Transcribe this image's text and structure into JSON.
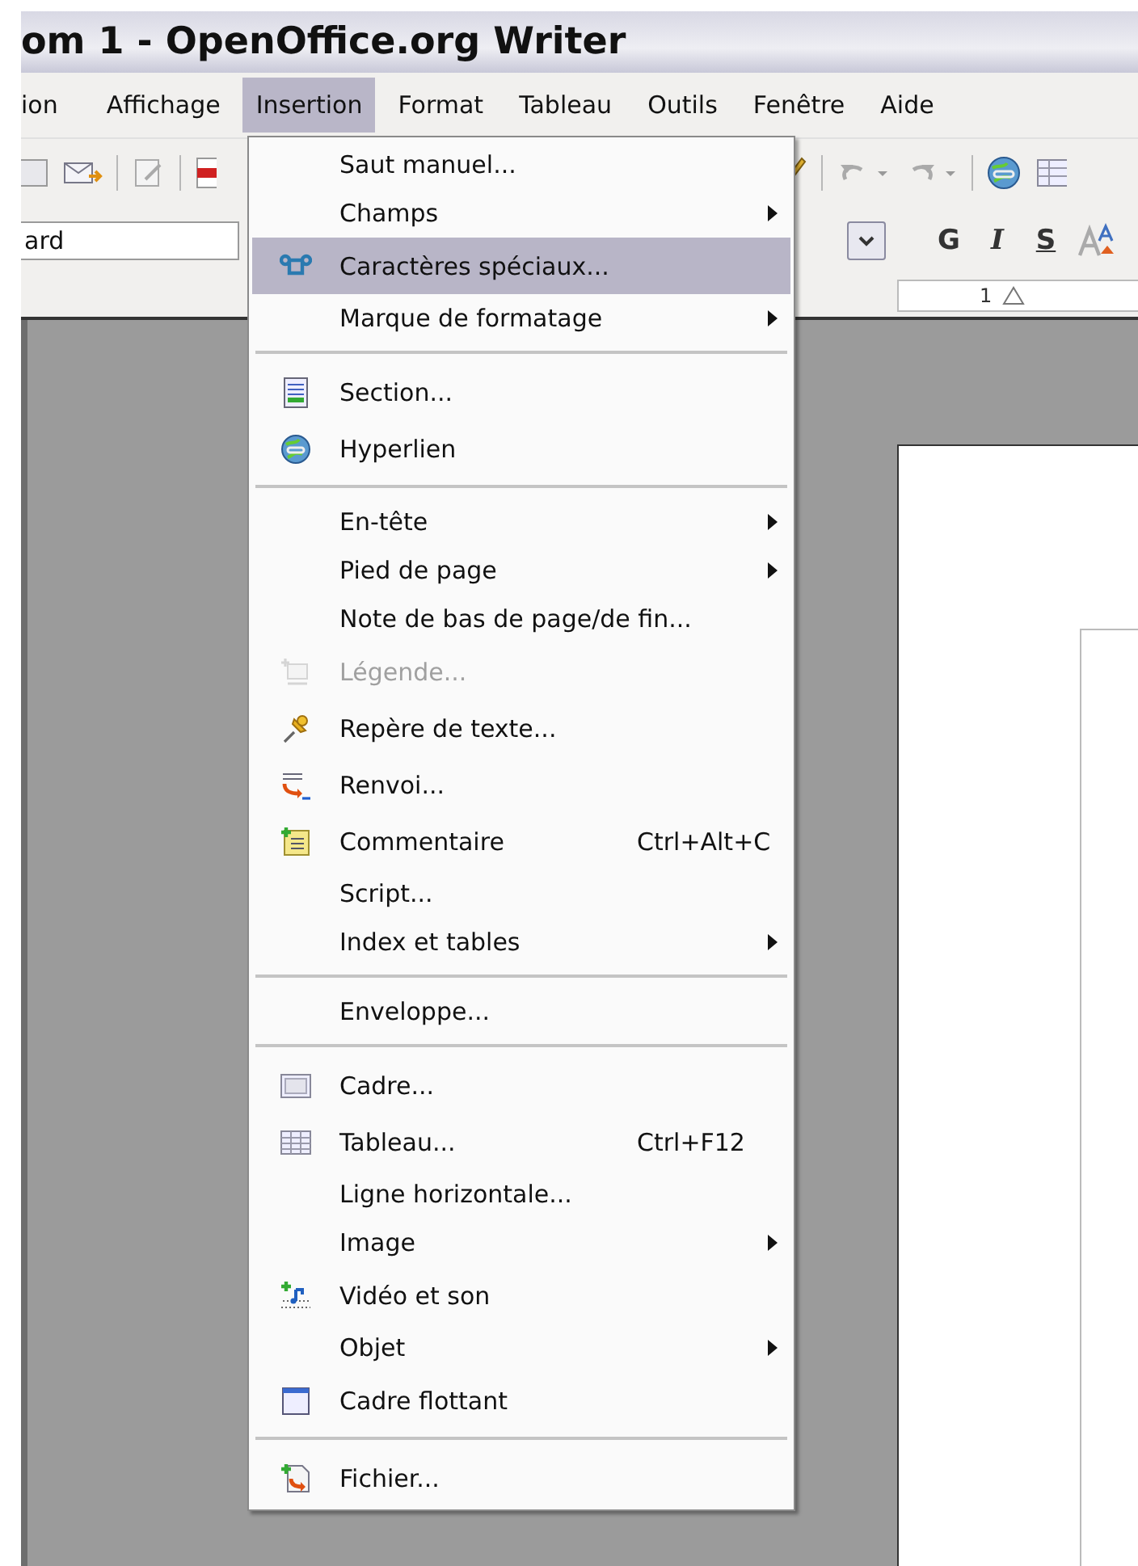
{
  "window": {
    "title": "om 1 - OpenOffice.org Writer"
  },
  "menubar": [
    {
      "label": "ion",
      "selected": false
    },
    {
      "label": "Affichage",
      "selected": false
    },
    {
      "label": "Insertion",
      "selected": true
    },
    {
      "label": "Format",
      "selected": false
    },
    {
      "label": "Tableau",
      "selected": false
    },
    {
      "label": "Outils",
      "selected": false
    },
    {
      "label": "Fenêtre",
      "selected": false
    },
    {
      "label": "Aide",
      "selected": false
    }
  ],
  "format_toolbar": {
    "style_field": {
      "value": "ard"
    },
    "buttons": [
      "G",
      "I",
      "S"
    ]
  },
  "ruler": {
    "label": "1"
  },
  "menu": {
    "items": [
      {
        "kind": "item",
        "label": "Saut manuel...",
        "submenu": false,
        "selected": false,
        "disabled": false
      },
      {
        "kind": "item",
        "label": "Champs",
        "submenu": true,
        "selected": false,
        "disabled": false
      },
      {
        "kind": "item",
        "label": "Caractères spéciaux...",
        "submenu": false,
        "selected": true,
        "disabled": false
      },
      {
        "kind": "item",
        "label": "Marque de formatage",
        "submenu": true,
        "selected": false,
        "disabled": false
      },
      {
        "kind": "separator"
      },
      {
        "kind": "item",
        "label": "Section...",
        "submenu": false,
        "selected": false,
        "disabled": false
      },
      {
        "kind": "item",
        "label": "Hyperlien",
        "submenu": false,
        "selected": false,
        "disabled": false
      },
      {
        "kind": "separator"
      },
      {
        "kind": "item",
        "label": "En-tête",
        "submenu": true,
        "selected": false,
        "disabled": false
      },
      {
        "kind": "item",
        "label": "Pied de page",
        "submenu": true,
        "selected": false,
        "disabled": false
      },
      {
        "kind": "item",
        "label": "Note de bas de page/de fin...",
        "submenu": false,
        "selected": false,
        "disabled": false
      },
      {
        "kind": "item",
        "label": "Légende...",
        "submenu": false,
        "selected": false,
        "disabled": true
      },
      {
        "kind": "item",
        "label": "Repère de texte...",
        "submenu": false,
        "selected": false,
        "disabled": false
      },
      {
        "kind": "item",
        "label": "Renvoi...",
        "submenu": false,
        "selected": false,
        "disabled": false
      },
      {
        "kind": "item",
        "label": "Commentaire",
        "shortcut": "Ctrl+Alt+C",
        "submenu": false,
        "selected": false,
        "disabled": false
      },
      {
        "kind": "item",
        "label": "Script...",
        "submenu": false,
        "selected": false,
        "disabled": false
      },
      {
        "kind": "item",
        "label": "Index et tables",
        "submenu": true,
        "selected": false,
        "disabled": false
      },
      {
        "kind": "separator"
      },
      {
        "kind": "item",
        "label": "Enveloppe...",
        "submenu": false,
        "selected": false,
        "disabled": false
      },
      {
        "kind": "separator"
      },
      {
        "kind": "item",
        "label": "Cadre...",
        "submenu": false,
        "selected": false,
        "disabled": false
      },
      {
        "kind": "item",
        "label": "Tableau...",
        "shortcut": "Ctrl+F12",
        "submenu": false,
        "selected": false,
        "disabled": false
      },
      {
        "kind": "item",
        "label": "Ligne horizontale...",
        "submenu": false,
        "selected": false,
        "disabled": false
      },
      {
        "kind": "item",
        "label": "Image",
        "submenu": true,
        "selected": false,
        "disabled": false
      },
      {
        "kind": "item",
        "label": "Vidéo et son",
        "submenu": false,
        "selected": false,
        "disabled": false
      },
      {
        "kind": "item",
        "label": "Objet",
        "submenu": true,
        "selected": false,
        "disabled": false
      },
      {
        "kind": "item",
        "label": "Cadre flottant",
        "submenu": false,
        "selected": false,
        "disabled": false
      },
      {
        "kind": "separator"
      },
      {
        "kind": "item",
        "label": "Fichier...",
        "submenu": false,
        "selected": false,
        "disabled": false
      }
    ]
  }
}
